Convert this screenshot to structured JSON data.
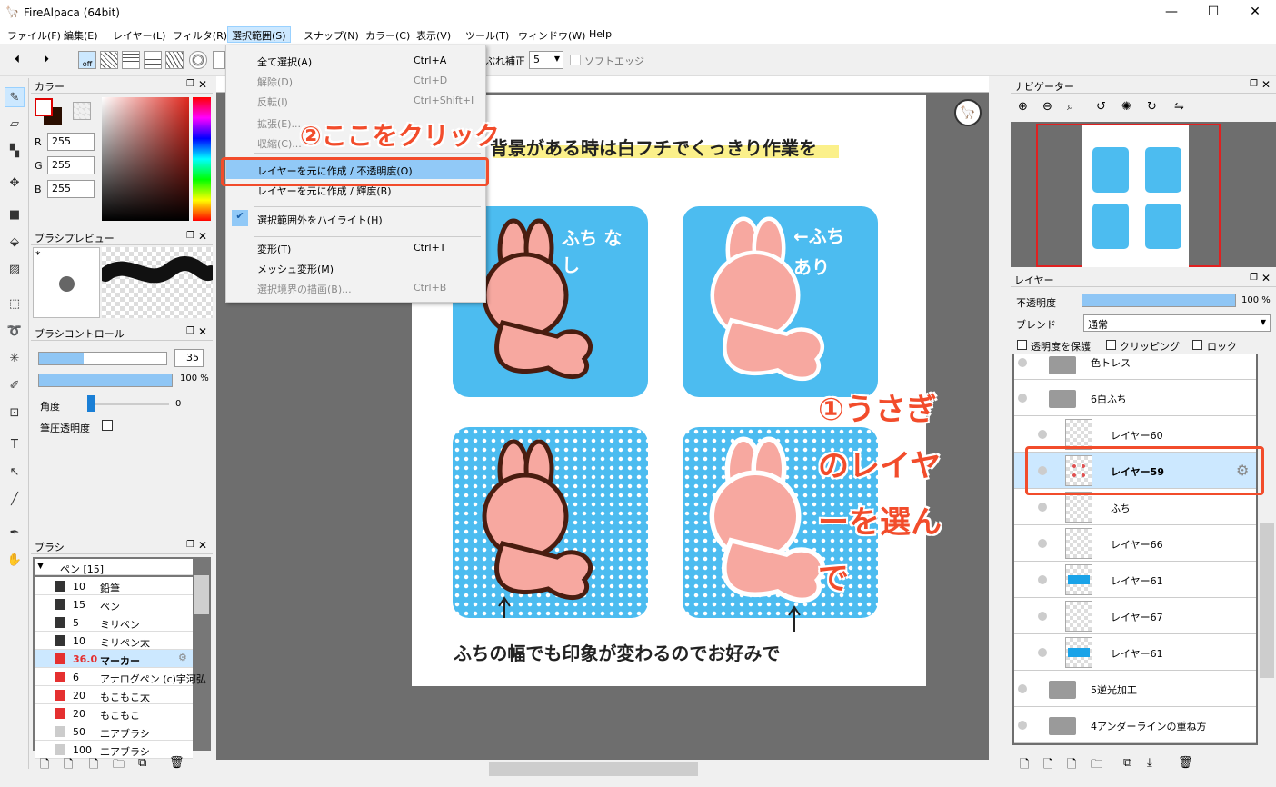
{
  "window": {
    "title": "FireAlpaca (64bit)",
    "minimize": "—",
    "maximize": "☐",
    "close": "✕"
  },
  "menubar": {
    "items": [
      "ファイル(F)",
      "編集(E)",
      "レイヤー(L)",
      "フィルタ(R)",
      "選択範囲(S)",
      "スナップ(N)",
      "カラー(C)",
      "表示(V)",
      "ツール(T)",
      "ウィンドウ(W)",
      "Help"
    ]
  },
  "toolbar": {
    "stabilizer_label": "ぶれ補正",
    "stabilizer_value": "5",
    "soft_edge_label": "ソフトエッジ",
    "off_label": "off"
  },
  "select_menu": {
    "items": [
      {
        "label": "全て選択(A)",
        "shortcut": "Ctrl+A"
      },
      {
        "label": "解除(D)",
        "shortcut": "Ctrl+D"
      },
      {
        "label": "反転(I)",
        "shortcut": "Ctrl+Shift+I"
      },
      {
        "label": "拡張(E)...",
        "shortcut": ""
      },
      {
        "label": "収縮(C)...",
        "shortcut": ""
      },
      {
        "label": "レイヤーを元に作成 / 不透明度(O)",
        "shortcut": ""
      },
      {
        "label": "レイヤーを元に作成 / 輝度(B)",
        "shortcut": ""
      },
      {
        "label": "選択範囲外をハイライト(H)",
        "shortcut": ""
      },
      {
        "label": "変形(T)",
        "shortcut": "Ctrl+T"
      },
      {
        "label": "メッシュ変形(M)",
        "shortcut": ""
      },
      {
        "label": "選択境界の描画(B)...",
        "shortcut": "Ctrl+B"
      }
    ]
  },
  "color_panel": {
    "title": "カラー",
    "r_label": "R",
    "g_label": "G",
    "b_label": "B",
    "r": "255",
    "g": "255",
    "b": "255",
    "fg_color": "#ffffff",
    "bg_color": "#2a0e00"
  },
  "brush_preview": {
    "title": "ブラシプレビュー",
    "star": "*"
  },
  "brush_control": {
    "title": "ブラシコントロール",
    "size": "35",
    "opacity": "100 %",
    "angle_label": "角度",
    "angle": "0",
    "pressure_label": "筆圧透明度",
    "size_fill": 0.35,
    "opacity_fill": 1.0
  },
  "brush_panel": {
    "title": "ブラシ",
    "group": "ペン [15]",
    "items": [
      {
        "size": "10",
        "name": "鉛筆",
        "color": "#333333"
      },
      {
        "size": "15",
        "name": "ペン",
        "color": "#333333"
      },
      {
        "size": "5",
        "name": "ミリペン",
        "color": "#333333"
      },
      {
        "size": "10",
        "name": "ミリペン太",
        "color": "#333333"
      },
      {
        "size": "36.0",
        "name": "マーカー",
        "color": "#e53030"
      },
      {
        "size": "6",
        "name": "アナログペン (c)宇河弘",
        "color": "#e53030"
      },
      {
        "size": "20",
        "name": "もこもこ太",
        "color": "#e53030"
      },
      {
        "size": "20",
        "name": "もこもこ",
        "color": "#e53030"
      },
      {
        "size": "50",
        "name": "エアブラシ",
        "color": "#cccccc"
      },
      {
        "size": "100",
        "name": "エアブラシ",
        "color": "#cccccc"
      }
    ]
  },
  "navigator": {
    "title": "ナビゲーター"
  },
  "layer_panel": {
    "title": "レイヤー",
    "opacity_label": "不透明度",
    "opacity": "100 %",
    "blend_label": "ブレンド",
    "blend": "通常",
    "protect_alpha": "透明度を保護",
    "clipping": "クリッピング",
    "lock": "ロック",
    "layers": [
      {
        "name": "色トレス",
        "kind": "folder"
      },
      {
        "name": "6白ふち",
        "kind": "folder-open"
      },
      {
        "name": "レイヤー60",
        "kind": "layer"
      },
      {
        "name": "レイヤー59",
        "kind": "layer"
      },
      {
        "name": "ふち",
        "kind": "layer"
      },
      {
        "name": "レイヤー66",
        "kind": "layer"
      },
      {
        "name": "レイヤー61",
        "kind": "layer"
      },
      {
        "name": "レイヤー67",
        "kind": "layer"
      },
      {
        "name": "レイヤー61",
        "kind": "layer"
      },
      {
        "name": "5逆光加工",
        "kind": "folder"
      },
      {
        "name": "4アンダーラインの重ね方",
        "kind": "folder"
      }
    ]
  },
  "artwork": {
    "heading": "背景がある時は白フチでくっきり作業を",
    "card1_text": "ふち なし",
    "card2_text": "←ふち あり",
    "bottom_caption": "ふちの幅でも印象が変わるのでお好みで",
    "annotation_click": "②ここをクリック",
    "annotation_select": "①うさぎのレイヤーを選んで"
  },
  "colors": {
    "accent": "#f24c2b",
    "card_blue": "#4cbcf0",
    "highlight": "#91c9f7"
  }
}
